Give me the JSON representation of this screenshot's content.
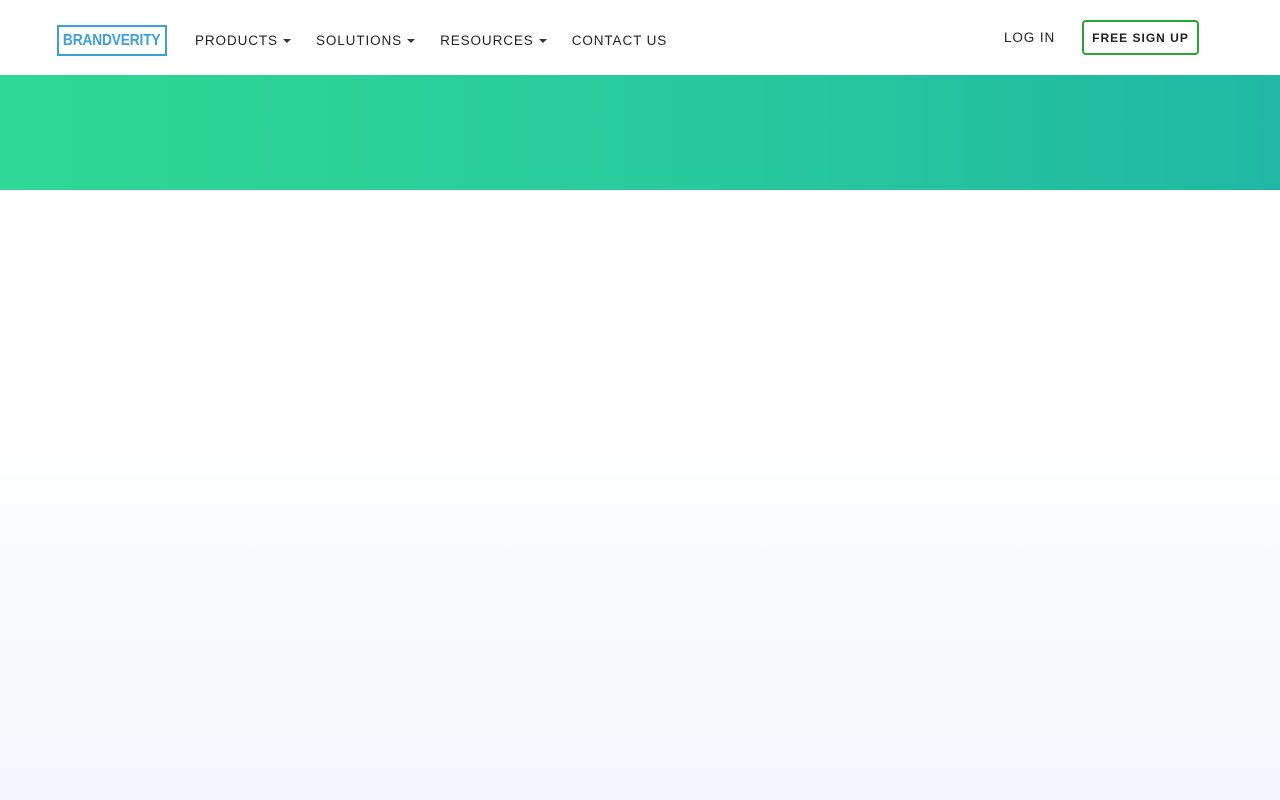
{
  "header": {
    "logo_text": "BRANDVERITY",
    "nav": [
      {
        "label": "PRODUCTS",
        "has_dropdown": true
      },
      {
        "label": "SOLUTIONS",
        "has_dropdown": true
      },
      {
        "label": "RESOURCES",
        "has_dropdown": true
      },
      {
        "label": "CONTACT US",
        "has_dropdown": false
      }
    ],
    "login_label": "LOG IN",
    "signup_label": "FREE SIGN UP"
  },
  "colors": {
    "logo": "#3d9fdc",
    "signup_border": "#23a834",
    "banner_start": "#2fd894",
    "banner_end": "#20b8a4",
    "nav_text": "#222222"
  },
  "icons": {
    "dropdown": "caret-down-icon"
  }
}
